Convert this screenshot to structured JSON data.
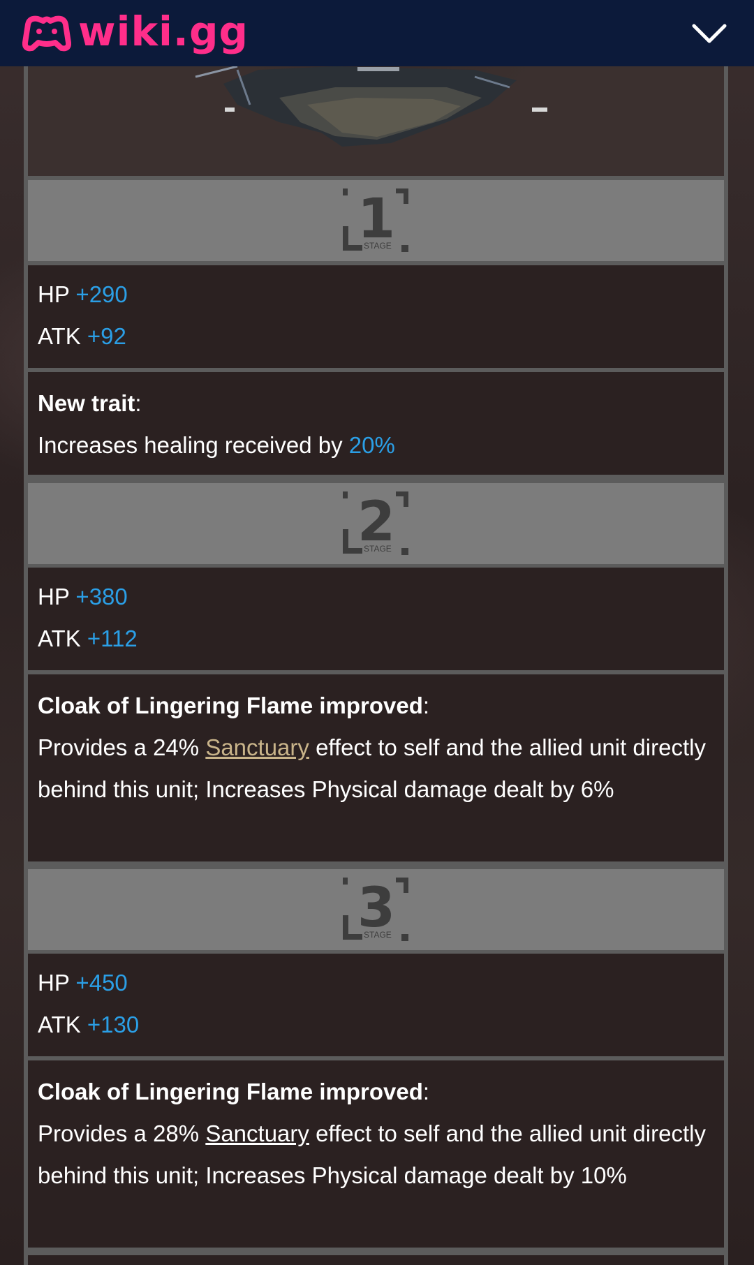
{
  "header": {
    "logo_text": "wiki.gg",
    "brand_color": "#ff2e8a",
    "bar_color": "#0c1a3a",
    "menu_icon": "chevron-down-icon"
  },
  "image_panel": {
    "alt_icon": "fortress-image"
  },
  "stage_label": "STAGE",
  "stages": [
    {
      "number": "1",
      "hp_label": "HP",
      "hp_value": "+290",
      "atk_label": "ATK",
      "atk_value": "+92",
      "trait_title": "New trait",
      "trait_colon": ":",
      "trait_text_prefix": "Increases healing received by ",
      "trait_value": "20%"
    },
    {
      "number": "2",
      "hp_label": "HP",
      "hp_value": "+380",
      "atk_label": "ATK",
      "atk_value": "+112",
      "trait_title": "Cloak of Lingering Flame improved",
      "trait_colon": ":",
      "trait_text_prefix": "Provides a 24% ",
      "trait_link": "Sanctuary",
      "trait_text_suffix": " effect to self and the allied unit directly behind this unit; Increases Physical damage dealt by 6%"
    },
    {
      "number": "3",
      "hp_label": "HP",
      "hp_value": "+450",
      "atk_label": "ATK",
      "atk_value": "+130",
      "trait_title": "Cloak of Lingering Flame improved",
      "trait_colon": ":",
      "trait_text_prefix": "Provides a 28% ",
      "trait_link": "Sanctuary",
      "trait_text_suffix": " effect to self and the allied unit directly behind this unit; Increases Physical damage dealt by 10%"
    }
  ],
  "colors": {
    "stat_value": "#2b9fe6",
    "link_visited": "#c9b48a",
    "stage_header_bg": "#7c7c7c",
    "row_bg": "#2b2121"
  }
}
